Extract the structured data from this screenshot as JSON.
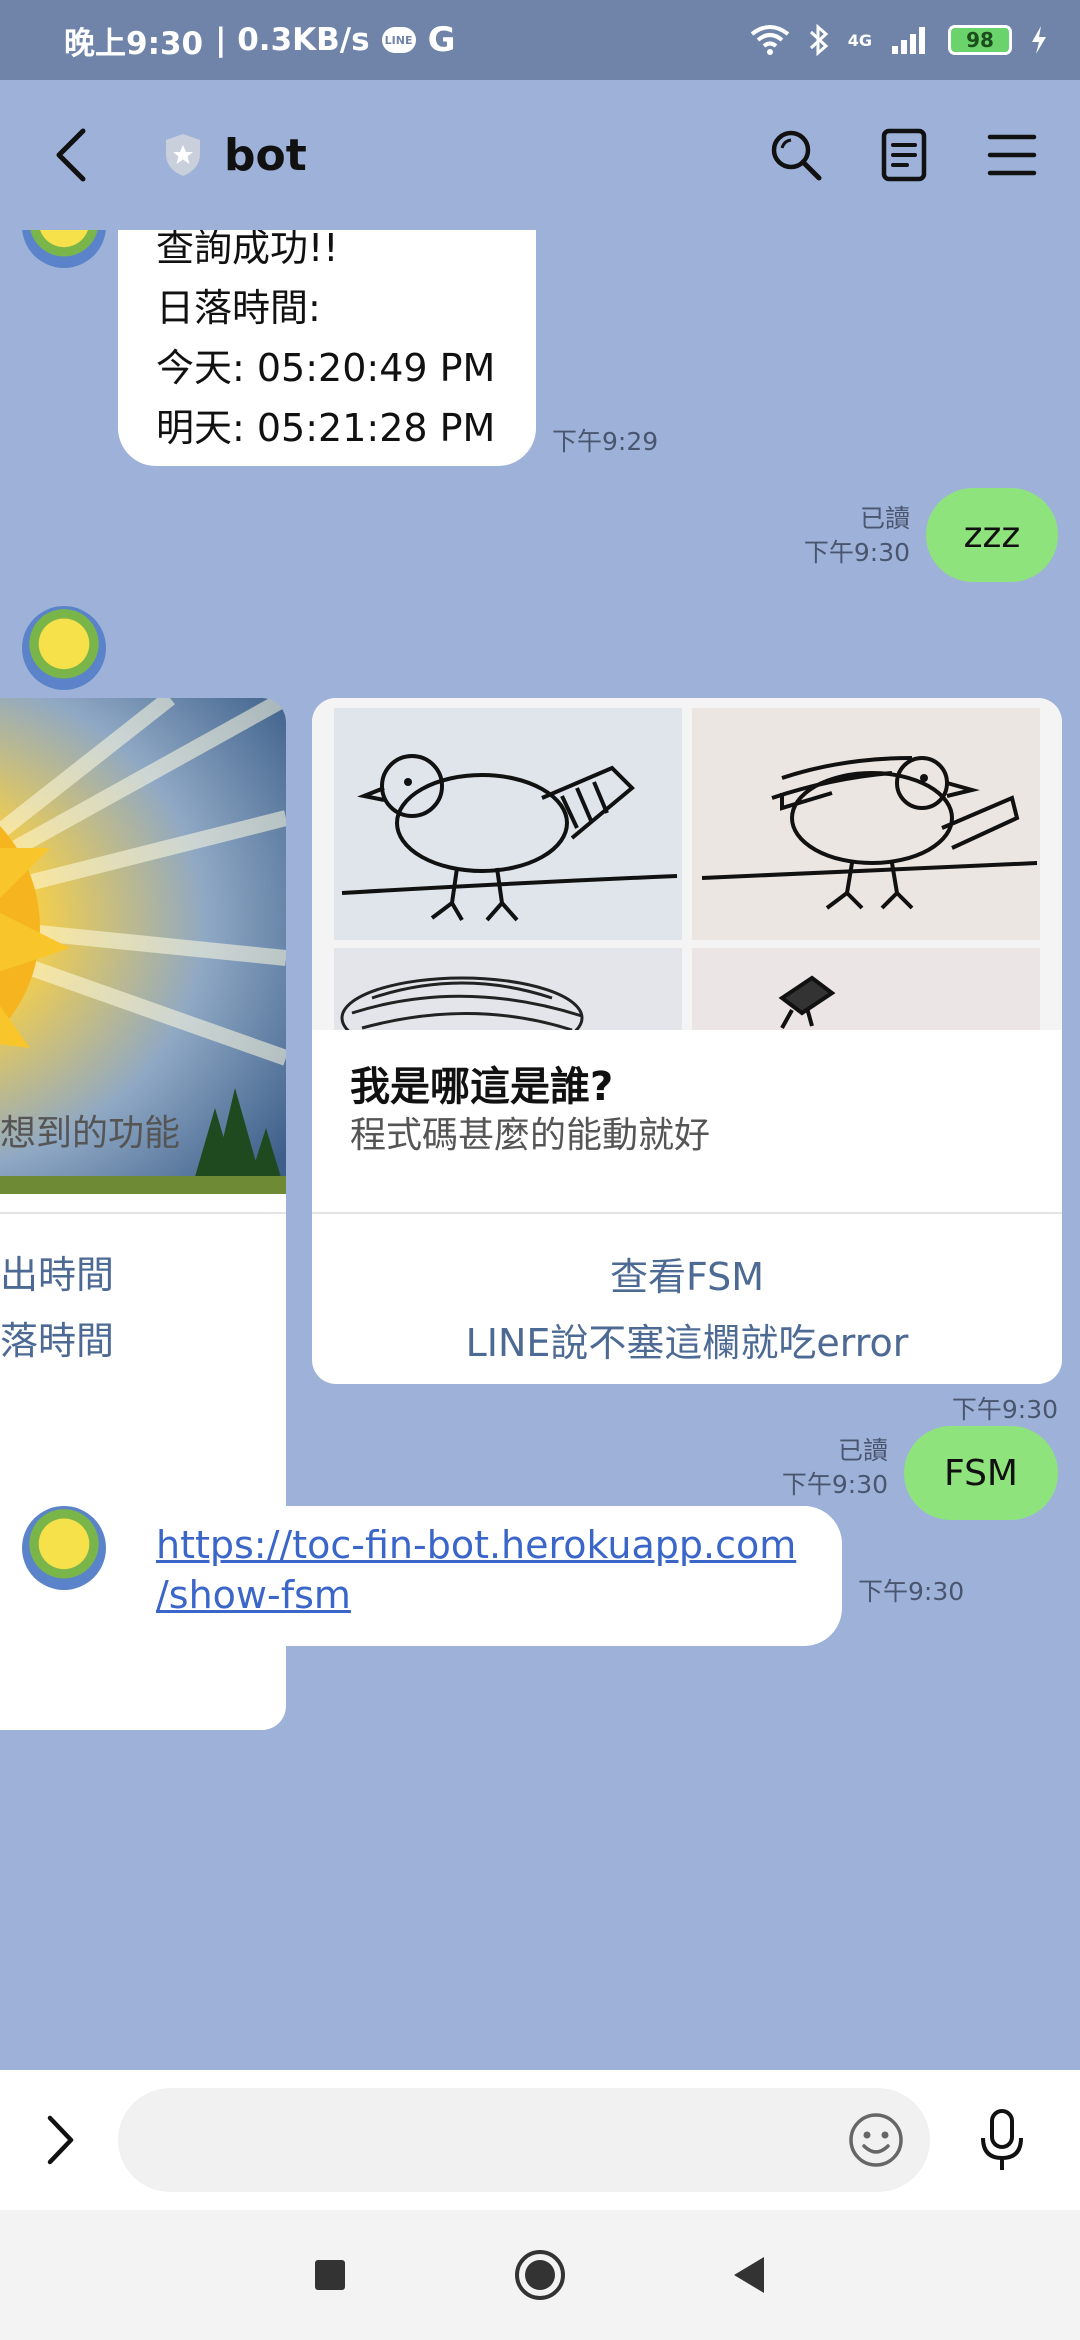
{
  "status_bar": {
    "time": "晚上9:30",
    "speed": "| 0.3KB/s",
    "line_badge": "LINE",
    "network": "4G",
    "battery": "98"
  },
  "header": {
    "title": "bot"
  },
  "messages": {
    "sunset_reply": {
      "line1": "查詢成功!!",
      "line2": "日落時間:",
      "line3": "今天: 05:20:49 PM",
      "line4": "明天: 05:21:28 PM",
      "time": "下午9:29"
    },
    "zzz": {
      "text": "zzz",
      "read": "已讀",
      "time": "下午9:30"
    },
    "carousel": {
      "time": "下午9:30",
      "card_left": {
        "text": "想到的功能",
        "action1": "出時間",
        "action2": "落時間"
      },
      "card_right": {
        "title": "我是哪這是誰?",
        "text": "程式碼甚麼的能動就好",
        "action1": "查看FSM",
        "action2": "LINE說不塞這欄就吃error"
      }
    },
    "fsm": {
      "text": "FSM",
      "read": "已讀",
      "time": "下午9:30"
    },
    "link_reply": {
      "line1": "https://toc-fin-bot.herokuapp.com",
      "line2": "/show-fsm",
      "time": "下午9:30"
    }
  },
  "input": {
    "placeholder": ""
  },
  "colors": {
    "chat_bg": "#9eb2d9",
    "outgoing_bubble": "#8fe37c",
    "card_action": "#4d6a94",
    "link": "#3b66c9"
  }
}
